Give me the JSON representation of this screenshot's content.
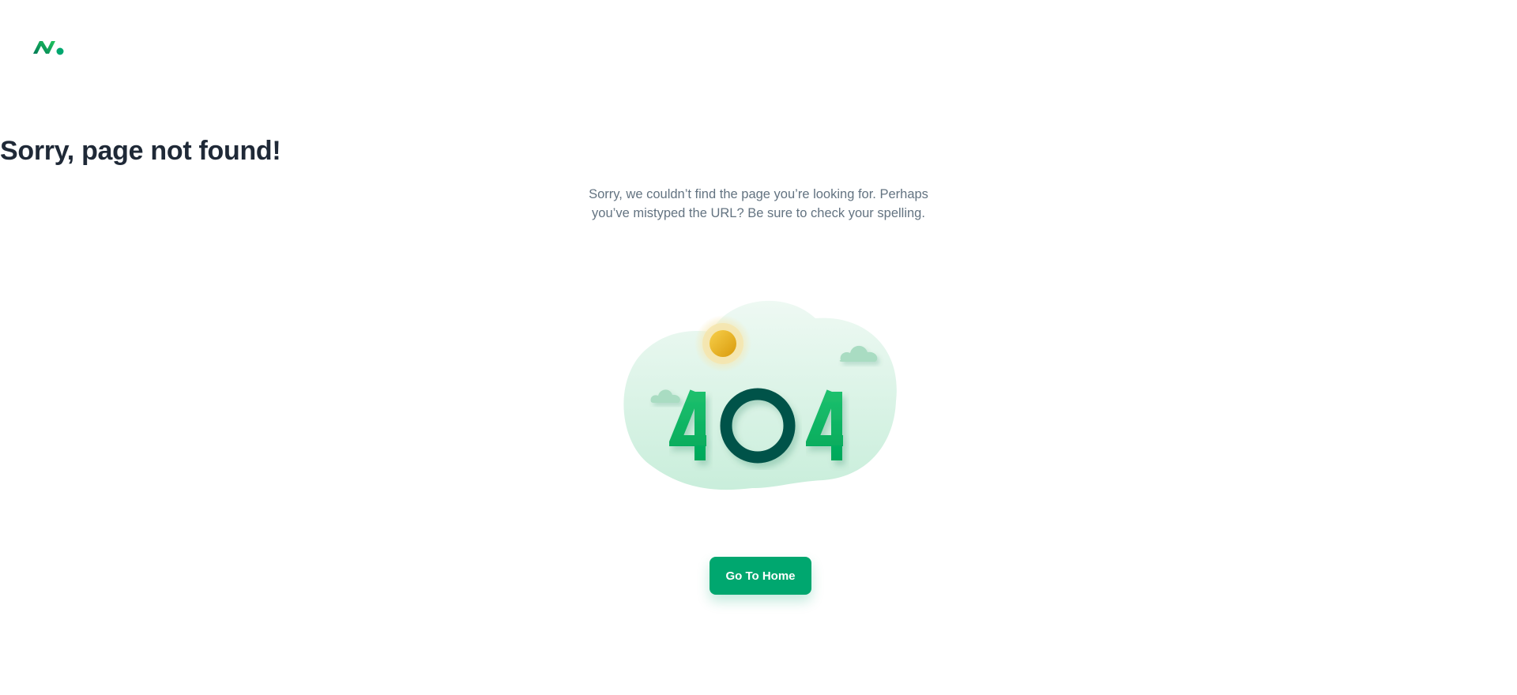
{
  "header": {
    "logo_icon": "brand-logo-icon"
  },
  "main": {
    "title": "Sorry, page not found!",
    "description": "Sorry, we couldn’t find the page you’re looking for. Perhaps you’ve mistyped the URL? Be sure to check your spelling.",
    "illustration": {
      "digit_1": "4",
      "digit_2": "0",
      "digit_3": "4",
      "icons": [
        "sun-icon",
        "cloud-icon",
        "cloud-icon"
      ]
    },
    "home_button_label": "Go To Home"
  },
  "colors": {
    "primary": "#00a76f",
    "primary_dark": "#004b50",
    "title": "#1f2937",
    "text_secondary": "#637381",
    "sun": "#f2b51a",
    "cloud_bg": "#d8f3e6"
  }
}
